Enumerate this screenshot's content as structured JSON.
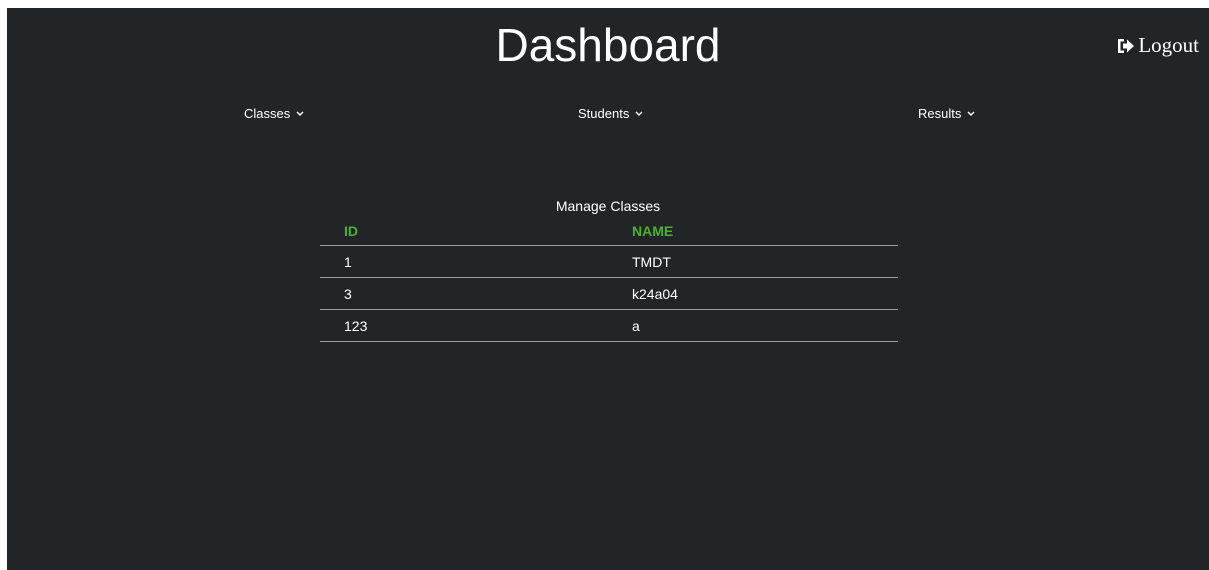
{
  "header": {
    "title": "Dashboard",
    "logout_label": "Logout",
    "logout_icon": "sign-out-icon"
  },
  "nav": {
    "items": [
      {
        "label": "Classes",
        "icon": "chevron-down-icon"
      },
      {
        "label": "Students",
        "icon": "chevron-down-icon"
      },
      {
        "label": "Results",
        "icon": "chevron-down-icon"
      }
    ]
  },
  "main": {
    "table_title": "Manage Classes",
    "columns": [
      "ID",
      "NAME"
    ],
    "rows": [
      {
        "id": "1",
        "name": "TMDT"
      },
      {
        "id": "3",
        "name": "k24a04"
      },
      {
        "id": "123",
        "name": "a"
      }
    ]
  },
  "colors": {
    "background": "#222528",
    "header_accent": "#4caf2e",
    "text": "#ffffff",
    "divider": "#9aa0a6"
  }
}
